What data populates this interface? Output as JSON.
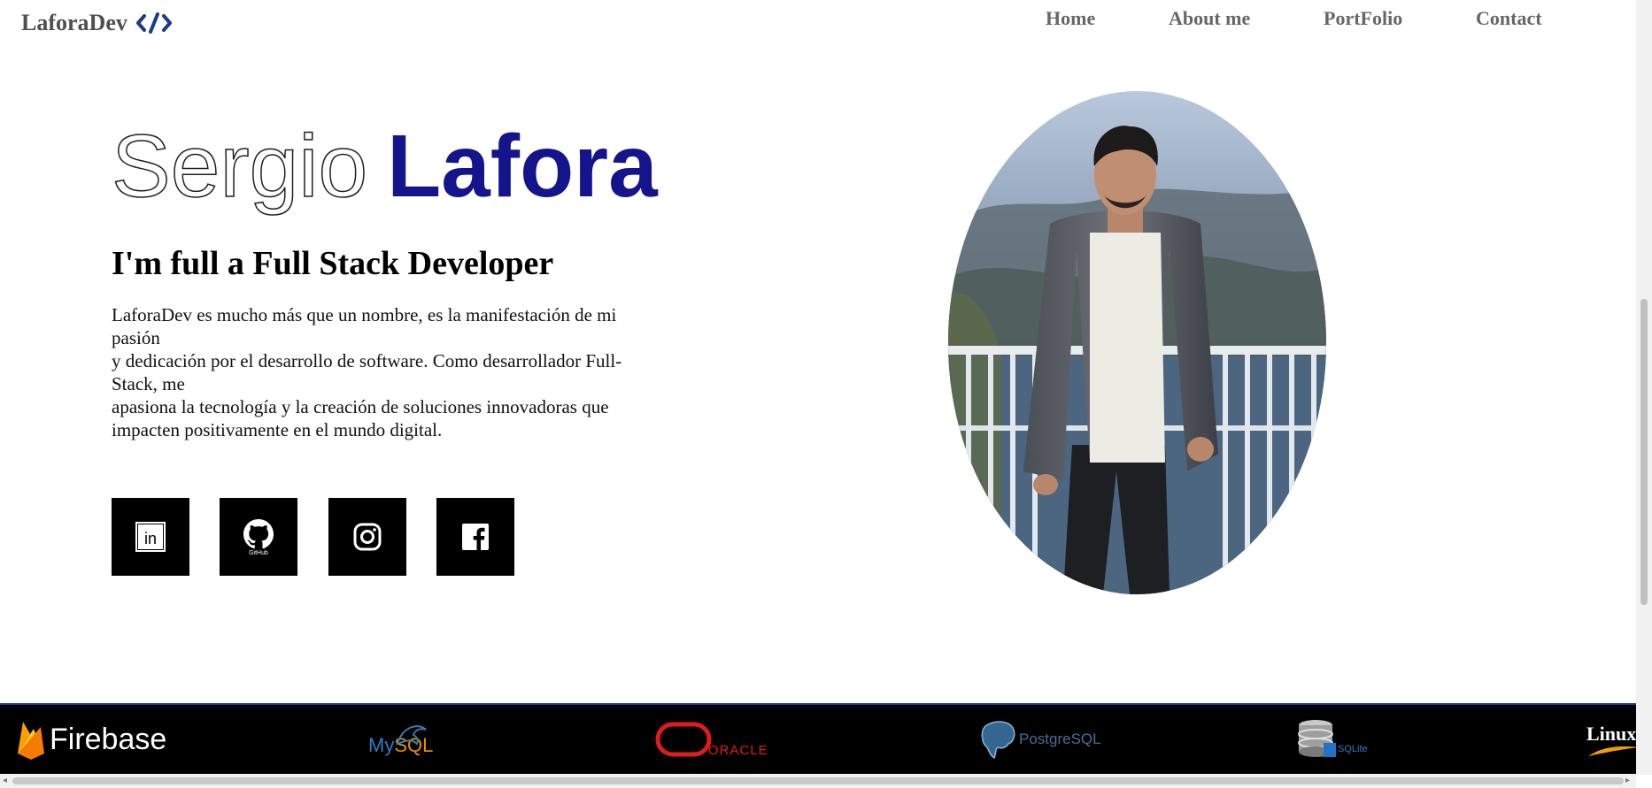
{
  "header": {
    "logo_text": "LaforaDev",
    "logo_icon": "code-slash-icon",
    "nav": [
      "Home",
      "About me",
      "PortFolio",
      "Contact"
    ]
  },
  "hero": {
    "first_name": "Sergio",
    "last_name": "Lafora",
    "subtitle": "I'm full a Full Stack Developer",
    "description_lines": [
      "LaforaDev es mucho más que un nombre, es la manifestación de mi",
      "pasión",
      "y dedicación por el desarrollo de software. Como desarrollador Full-",
      "Stack, me",
      "apasiona la tecnología y la creación de soluciones innovadoras que",
      "impacten positivamente en el mundo digital."
    ]
  },
  "social": [
    {
      "name": "linkedin",
      "icon": "linkedin-icon",
      "label": "in"
    },
    {
      "name": "github",
      "icon": "github-icon",
      "label": "GitHub"
    },
    {
      "name": "instagram",
      "icon": "instagram-icon"
    },
    {
      "name": "facebook",
      "icon": "facebook-icon"
    }
  ],
  "portrait": {
    "subject": "profile-photo"
  },
  "tech_logos": [
    {
      "name": "Firebase",
      "text": "Firebase"
    },
    {
      "name": "MySQL",
      "text_a": "My",
      "text_b": "SQL"
    },
    {
      "name": "Oracle",
      "text": "ORACLE"
    },
    {
      "name": "PostgreSQL",
      "text": "PostgreSQL"
    },
    {
      "name": "SQLite",
      "text": "SQLite"
    },
    {
      "name": "Linux",
      "text": "Linux"
    }
  ],
  "colors": {
    "accent": "#14148c",
    "nav_text": "#666666",
    "logo_text": "#4f4f4f",
    "strip_bg": "#000000"
  }
}
